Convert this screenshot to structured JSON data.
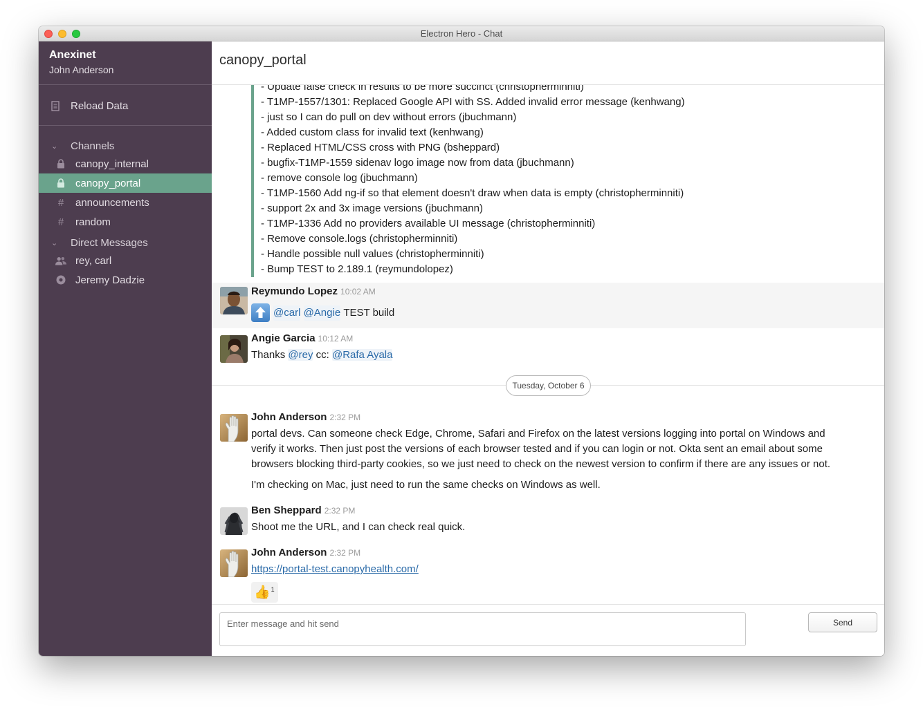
{
  "window": {
    "title": "Electron Hero - Chat"
  },
  "sidebar": {
    "team": "Anexinet",
    "user": "John Anderson",
    "reload_label": "Reload Data",
    "channels_label": "Channels",
    "channels": [
      {
        "name": "canopy_internal",
        "icon": "lock-icon"
      },
      {
        "name": "canopy_portal",
        "icon": "lock-icon",
        "active": true
      },
      {
        "name": "announcements",
        "icon": "hash-icon"
      },
      {
        "name": "random",
        "icon": "hash-icon"
      }
    ],
    "dm_label": "Direct Messages",
    "dms": [
      {
        "name": "rey, carl",
        "icon": "people-icon"
      },
      {
        "name": "Jeremy Dadzie",
        "icon": "presence-icon"
      }
    ]
  },
  "channel": {
    "title": "canopy_portal"
  },
  "changelog": [
    "- Update false check in results to be more succinct (christopherminniti)",
    "- T1MP-1557/1301: Replaced Google API with SS. Added invalid error message (kenhwang)",
    "- just so I can do pull on dev without errors (jbuchmann)",
    "- Added custom class for invalid text (kenhwang)",
    "- Replaced HTML/CSS cross with PNG (bsheppard)",
    "- bugfix-T1MP-1559 sidenav logo image now from data (jbuchmann)",
    "- remove console log (jbuchmann)",
    "- T1MP-1560 Add ng-if so that element doesn't draw when data is empty (christopherminniti)",
    "- support 2x and 3x image versions (jbuchmann)",
    "- T1MP-1336 Add no providers available UI message (christopherminniti)",
    "- Remove console.logs (christopherminniti)",
    "- Handle possible null values (christopherminniti)",
    "- Bump TEST to 2.189.1 (reymundolopez)"
  ],
  "messages": [
    {
      "author": "Reymundo Lopez",
      "time": "10:02 AM",
      "mention1": "@carl",
      "mention2": "@Angie",
      "text": "TEST build",
      "emoji": "up-arrow-icon"
    },
    {
      "author": "Angie Garcia",
      "time": "10:12 AM",
      "pre": "Thanks",
      "mention1": "@rey",
      "mid": "cc:",
      "mention2": "@Rafa Ayala"
    },
    {
      "author": "John Anderson",
      "time": "2:32 PM",
      "text": "portal devs. Can someone check Edge, Chrome, Safari and Firefox on the latest versions logging into portal on Windows and verify it works. Then just post the versions of each browser tested and if you can login or not. Okta sent an email about some browsers blocking third-party cookies, so we just need to check on the newest version to confirm if there are any issues or not.",
      "text2": "I'm checking on Mac, just need to run the same checks on Windows as well."
    },
    {
      "author": "Ben Sheppard",
      "time": "2:32 PM",
      "text": "Shoot me the URL, and I can check real quick."
    },
    {
      "author": "John Anderson",
      "time": "2:32 PM",
      "link": "https://portal-test.canopyhealth.com/",
      "reaction_emoji": "👍",
      "reaction_count": "1"
    }
  ],
  "day_divider": "Tuesday, October 6",
  "composer": {
    "placeholder": "Enter message and hit send",
    "send_label": "Send"
  },
  "colors": {
    "sidebar": "#4d3d4f",
    "active": "#6aa38c",
    "link": "#2a6aa8"
  }
}
